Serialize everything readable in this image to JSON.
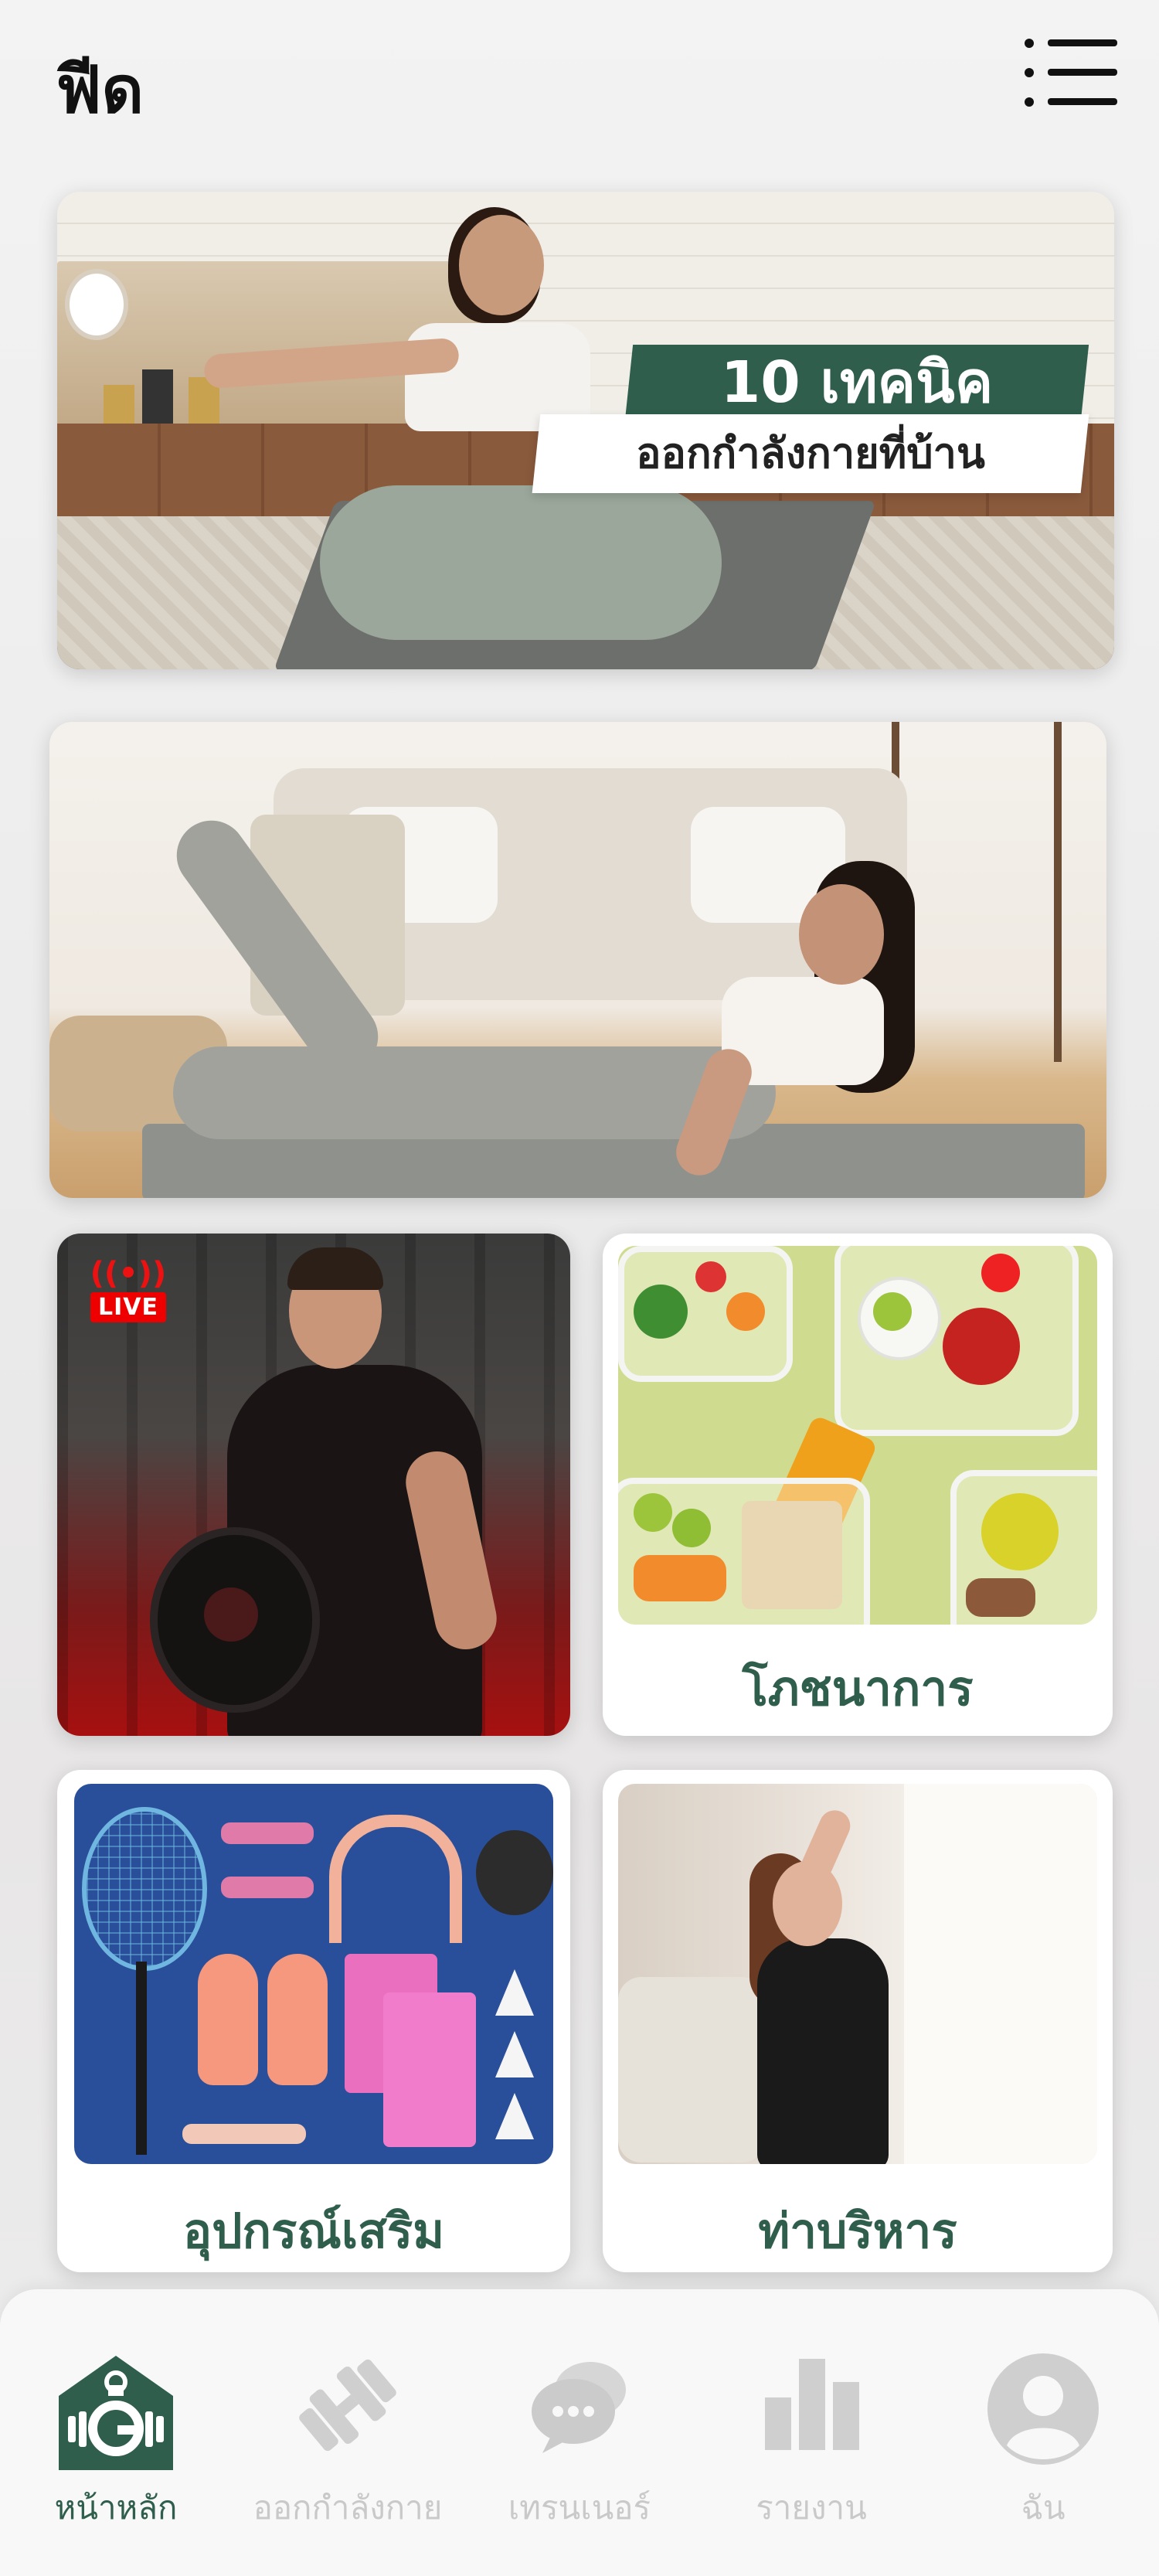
{
  "header": {
    "title": "ฟีด",
    "menu_icon": "hamburger-menu-icon"
  },
  "banners": [
    {
      "headline": "10 เทคนิค",
      "subline": "ออกกำลังกายที่บ้าน"
    },
    {
      "headline": "",
      "subline": ""
    }
  ],
  "tiles": {
    "live": {
      "badge": "LIVE"
    },
    "nutrition": {
      "label": "โภชนาการ"
    },
    "equipment": {
      "label": "อุปกรณ์เสริม"
    },
    "exercise": {
      "label": "ท่าบริหาร"
    }
  },
  "bottom_nav": {
    "items": [
      {
        "label": "หน้าหลัก",
        "icon": "home-gym-icon",
        "active": true
      },
      {
        "label": "ออกกำลังกาย",
        "icon": "dumbbell-icon",
        "active": false
      },
      {
        "label": "เทรนเนอร์",
        "icon": "chat-bubble-icon",
        "active": false
      },
      {
        "label": "รายงาน",
        "icon": "bar-chart-icon",
        "active": false
      },
      {
        "label": "ฉัน",
        "icon": "profile-icon",
        "active": false
      }
    ]
  },
  "colors": {
    "brand_green": "#2f5e4c",
    "live_red": "#e00000",
    "inactive_gray": "#c9c9c9"
  }
}
